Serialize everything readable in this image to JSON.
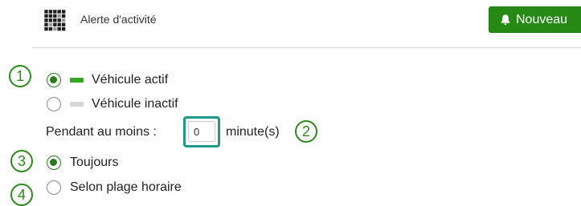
{
  "header": {
    "title": "Alerte d'activité",
    "new_button_label": "Nouveau",
    "new_button_icon": "bell-icon",
    "grid_icon": "grid-icon",
    "accent_color": "#258a14"
  },
  "callouts": [
    "1",
    "2",
    "3",
    "4"
  ],
  "status_options": [
    {
      "label": "Véhicule actif",
      "selected": true,
      "swatch_color": "#2ea81c"
    },
    {
      "label": "Véhicule inactif",
      "selected": false,
      "swatch_color": "#d6d6d6"
    }
  ],
  "duration": {
    "prefix": "Pendant au moins :",
    "value": "0",
    "unit": "minute(s)",
    "highlight_color": "#1f9a86"
  },
  "schedule_options": [
    {
      "label": "Toujours",
      "selected": true
    },
    {
      "label": "Selon plage horaire",
      "selected": false
    }
  ]
}
